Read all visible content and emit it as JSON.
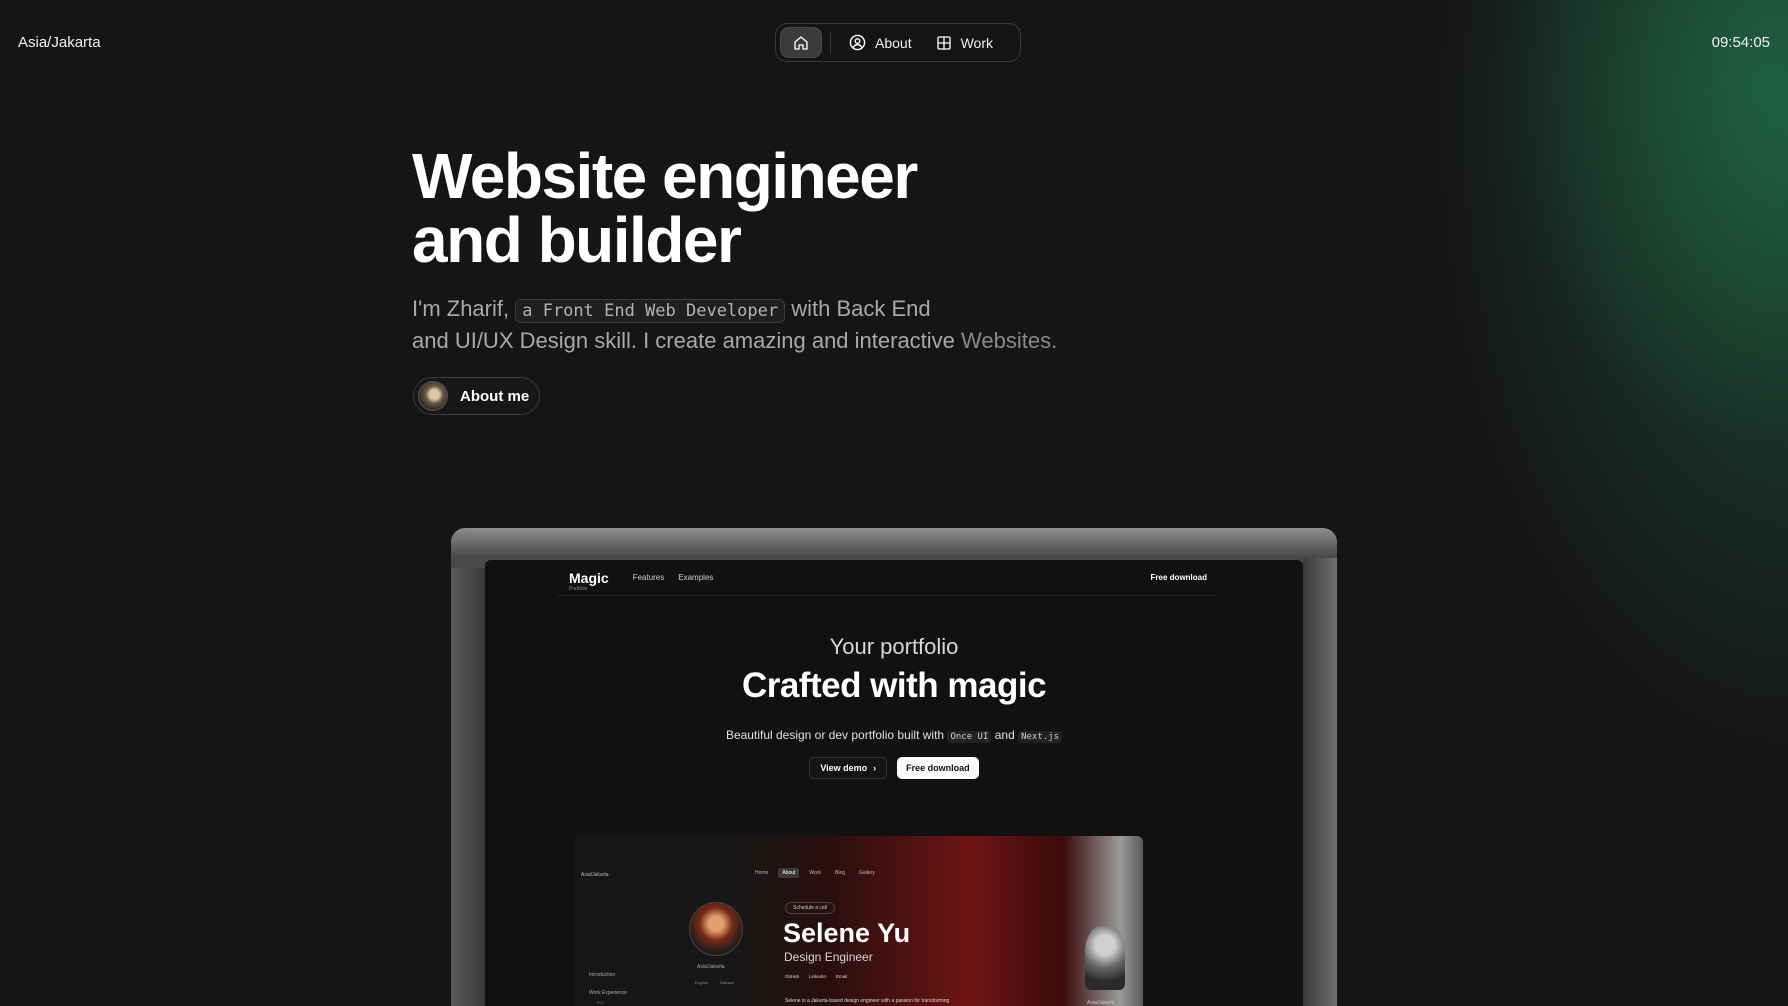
{
  "header": {
    "timezone": "Asia/Jakarta",
    "clock": "09:54:05",
    "nav": [
      {
        "label": "",
        "icon": "home-icon"
      },
      {
        "label": "About",
        "icon": "user-circle-icon"
      },
      {
        "label": "Work",
        "icon": "grid-icon"
      }
    ]
  },
  "hero": {
    "title_line1": "Website engineer",
    "title_line2": "and builder",
    "intro_prefix": "I'm Zharif,",
    "role_chip": "a Front End Web Developer",
    "intro_mid": "with Back End",
    "intro_line2": "and UI/UX Design skill. I create amazing and interactive",
    "intro_highlight": "Websites.",
    "about_button": "About me"
  },
  "showcase": {
    "nav_logo": "Magic",
    "nav_logo_sub": "Portfolio",
    "nav_links": [
      "Features",
      "Examples"
    ],
    "nav_download": "Free download",
    "superline": "Your portfolio",
    "title": "Crafted with magic",
    "desc_prefix": "Beautiful design or dev portfolio built with",
    "desc_code1": "Once UI",
    "desc_and": "and",
    "desc_code2": "Next.js",
    "btn_demo": "View demo",
    "btn_download": "Free download",
    "inner": {
      "timezone": "Asia/Jakarta",
      "nav": [
        "Home",
        "About",
        "Work",
        "Blog",
        "Gallery"
      ],
      "location": "Asia/Jakarta",
      "tags": [
        "English",
        "Bahasa"
      ],
      "side_items": [
        "Introduction",
        "Work Experience",
        "FLY"
      ],
      "schedule": "Schedule a call",
      "name": "Selene Yu",
      "role": "Design Engineer",
      "links": [
        "GitHub",
        "LinkedIn",
        "Email"
      ],
      "bio": "Selene is a Jakarta-based design engineer with a passion for transforming",
      "location2": "Asia/Jakarta"
    }
  },
  "colors": {
    "background": "#151515",
    "glow": "#228054",
    "accent_red": "#6e1414"
  }
}
